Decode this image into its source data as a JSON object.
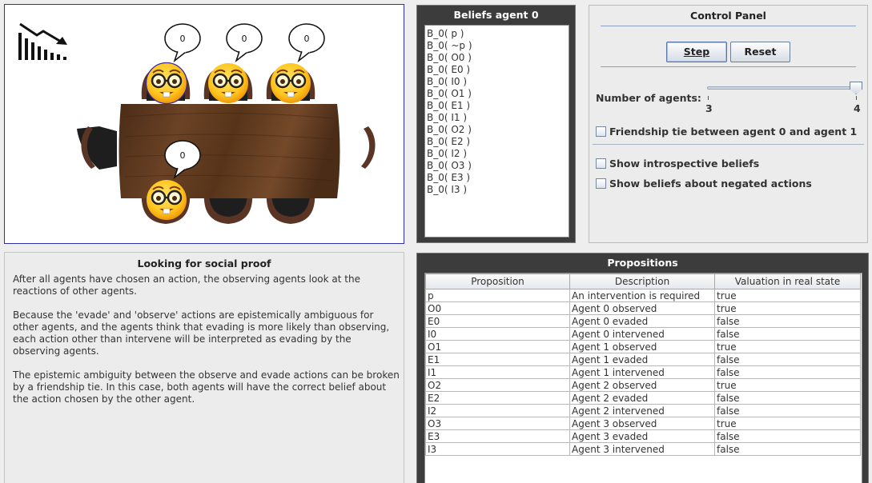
{
  "scene": {
    "speech_bubbles": [
      "0",
      "0",
      "0",
      "0"
    ],
    "logo_icon": "declining-chart-icon"
  },
  "beliefs": {
    "title": "Beliefs agent 0",
    "items": [
      "B_0( p )",
      "B_0( ~p )",
      "B_0( O0 )",
      "B_0( E0 )",
      "B_0( I0 )",
      "B_0( O1 )",
      "B_0( E1 )",
      "B_0( I1 )",
      "B_0( O2 )",
      "B_0( E2 )",
      "B_0( I2 )",
      "B_0( O3 )",
      "B_0( E3 )",
      "B_0( I3 )"
    ]
  },
  "control": {
    "title": "Control Panel",
    "step_label": "Step",
    "reset_label": "Reset",
    "num_agents_label": "Number of agents:",
    "slider_min": "3",
    "slider_max": "4",
    "slider_value": 4,
    "friendship_label": "Friendship tie between agent 0 and agent 1",
    "introspective_label": "Show introspective beliefs",
    "negated_label": "Show beliefs about negated actions"
  },
  "explain": {
    "title": "Looking for social proof",
    "paragraphs": [
      "After all agents have chosen an action, the observing agents look at the reactions of other agents.",
      "Because the 'evade' and 'observe' actions are epistemically ambiguous for other agents, and the agents think that evading is more likely than observing, each action other than intervene will be interpreted as evading by the observing agents.",
      "The epistemic ambiguity between the observe and evade actions can be broken by a friendship tie. In this case, both agents will have the correct belief about the action chosen by the other agent."
    ]
  },
  "props": {
    "title": "Propositions",
    "headers": [
      "Proposition",
      "Description",
      "Valuation in real state"
    ],
    "rows": [
      [
        "p",
        "An intervention is required",
        "true"
      ],
      [
        "O0",
        "Agent 0 observed",
        "true"
      ],
      [
        "E0",
        "Agent 0 evaded",
        "false"
      ],
      [
        "I0",
        "Agent 0 intervened",
        "false"
      ],
      [
        "O1",
        "Agent 1 observed",
        "true"
      ],
      [
        "E1",
        "Agent 1 evaded",
        "false"
      ],
      [
        "I1",
        "Agent 1 intervened",
        "false"
      ],
      [
        "O2",
        "Agent 2 observed",
        "true"
      ],
      [
        "E2",
        "Agent 2 evaded",
        "false"
      ],
      [
        "I2",
        "Agent 2 intervened",
        "false"
      ],
      [
        "O3",
        "Agent 3 observed",
        "true"
      ],
      [
        "E3",
        "Agent 3 evaded",
        "false"
      ],
      [
        "I3",
        "Agent 3 intervened",
        "false"
      ]
    ]
  }
}
